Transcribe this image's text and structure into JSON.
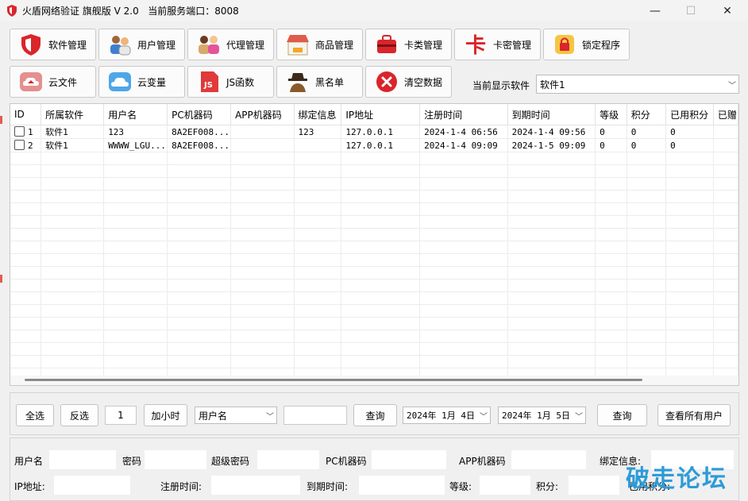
{
  "window": {
    "title": "火盾网络验证 旗舰版 V 2.0",
    "port_label": "当前服务端口：8008",
    "minimize": "—",
    "maximize": "☐",
    "close": "✕"
  },
  "toolbar": {
    "row1": [
      {
        "label": "软件管理",
        "icon": "shield-icon"
      },
      {
        "label": "用户管理",
        "icon": "users-icon"
      },
      {
        "label": "代理管理",
        "icon": "agents-icon"
      },
      {
        "label": "商品管理",
        "icon": "shop-icon"
      },
      {
        "label": "卡类管理",
        "icon": "toolbox-icon"
      },
      {
        "label": "卡密管理",
        "icon": "card-icon"
      },
      {
        "label": "锁定程序",
        "icon": "lock-icon"
      }
    ],
    "row2": [
      {
        "label": "云文件",
        "icon": "cloud-upload-icon"
      },
      {
        "label": "云变量",
        "icon": "cloud-icon"
      },
      {
        "label": "JS函数",
        "icon": "js-icon"
      },
      {
        "label": "黑名单",
        "icon": "spy-icon"
      },
      {
        "label": "清空数据",
        "icon": "clear-icon"
      }
    ]
  },
  "software_selector": {
    "label": "当前显示软件",
    "value": "软件1"
  },
  "table": {
    "columns": [
      "ID",
      "所属软件",
      "用户名",
      "PC机器码",
      "APP机器码",
      "绑定信息",
      "IP地址",
      "注册时间",
      "到期时间",
      "等级",
      "积分",
      "已用积分",
      "已赠"
    ],
    "rows": [
      {
        "id": "1",
        "software": "软件1",
        "username": "123",
        "pc_code": "8A2EF008...",
        "app_code": "",
        "bind_info": "123",
        "ip": "127.0.0.1",
        "reg_time": "2024-1-4 06:56",
        "expire_time": "2024-1-4 09:56",
        "level": "0",
        "points": "0",
        "used_points": "0",
        "gifted": ""
      },
      {
        "id": "2",
        "software": "软件1",
        "username": "WWWW_LGU...",
        "pc_code": "8A2EF008...",
        "app_code": "",
        "bind_info": "",
        "ip": "127.0.0.1",
        "reg_time": "2024-1-4 09:09",
        "expire_time": "2024-1-5 09:09",
        "level": "0",
        "points": "0",
        "used_points": "0",
        "gifted": ""
      }
    ]
  },
  "query_bar": {
    "select_all": "全选",
    "invert": "反选",
    "hours_value": "1",
    "add_hours": "加小时",
    "field_select": "用户名",
    "search_value": "",
    "query": "查询",
    "date_from": "2024年 1月 4日",
    "date_to": "2024年 1月 5日",
    "query2": "查询",
    "view_all": "查看所有用户"
  },
  "detail_form": {
    "username": "用户名",
    "password": "密码",
    "super_password": "超级密码",
    "pc_code": "PC机器码",
    "app_code": "APP机器码",
    "bind_info": "绑定信息:",
    "ip": "IP地址:",
    "reg_time": "注册时间:",
    "expire_time": "到期时间:",
    "level": "等级:",
    "points": "积分:",
    "used_points": "已用积分:"
  },
  "watermark": "破走论坛",
  "colors": {
    "accent_red": "#d9252b",
    "watermark_blue": "#2d9bd8",
    "window_bg": "#f0f0f0"
  }
}
